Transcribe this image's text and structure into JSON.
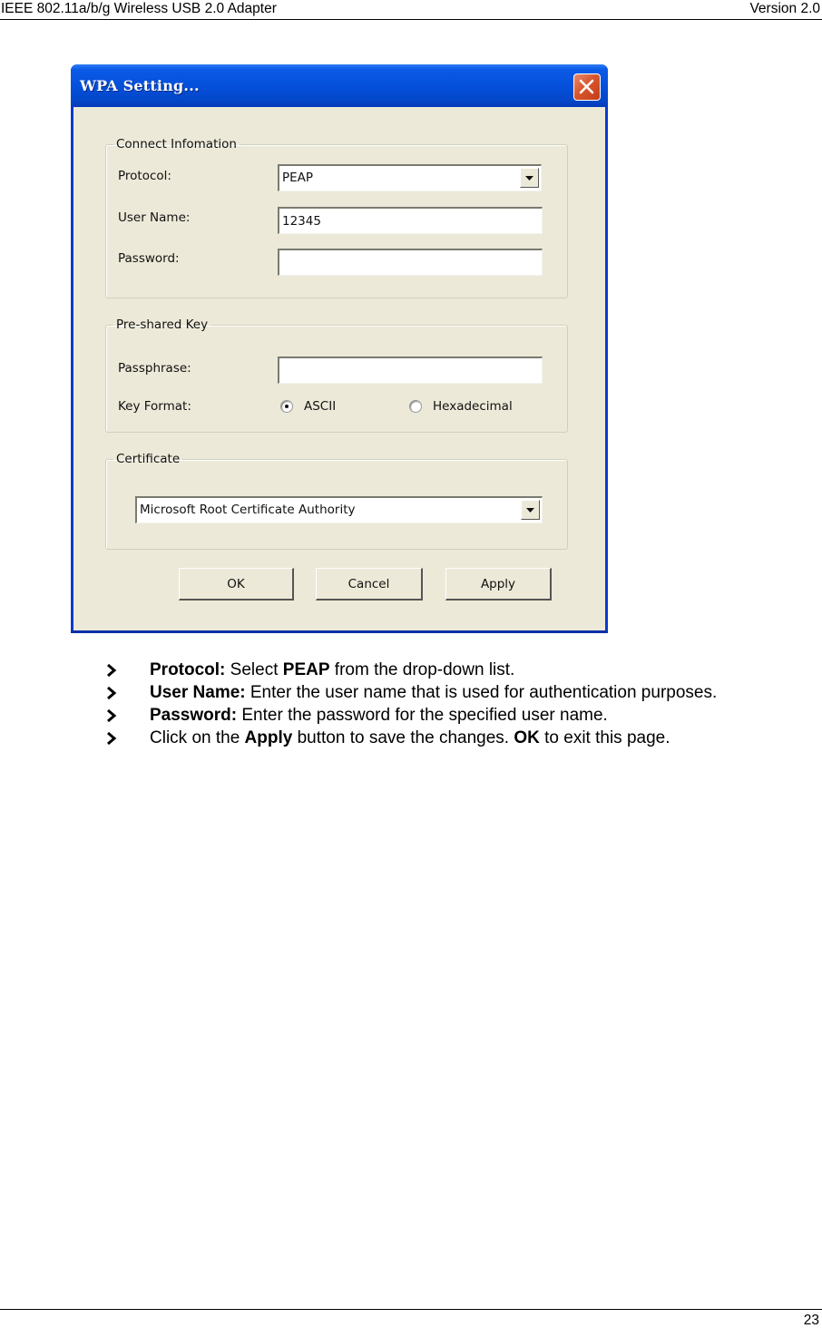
{
  "page_header": {
    "left": "IEEE 802.11a/b/g Wireless USB 2.0 Adapter",
    "right": "Version 2.0"
  },
  "dialog": {
    "title": "WPA Setting...",
    "close_icon": "close-icon",
    "connect_group": {
      "legend": "Connect Infomation",
      "protocol_label": "Protocol:",
      "protocol_value": "PEAP",
      "username_label": "User Name:",
      "username_value": "12345",
      "password_label": "Password:",
      "password_value": ""
    },
    "psk_group": {
      "legend": "Pre-shared Key",
      "passphrase_label": "Passphrase:",
      "passphrase_value": "",
      "keyformat_label": "Key Format:",
      "options": [
        {
          "label": "ASCII",
          "selected": true
        },
        {
          "label": "Hexadecimal",
          "selected": false
        }
      ]
    },
    "certificate_group": {
      "legend": "Certificate",
      "value": "Microsoft Root Certificate Authority"
    },
    "buttons": {
      "ok": "OK",
      "cancel": "Cancel",
      "apply": "Apply"
    }
  },
  "bullets": [
    {
      "parts": [
        {
          "b": "Protocol:"
        },
        {
          "t": " Select "
        },
        {
          "b": "PEAP"
        },
        {
          "t": " from the drop-down list."
        }
      ]
    },
    {
      "parts": [
        {
          "b": "User Name:"
        },
        {
          "t": " Enter the user name that is used for authentication purposes."
        }
      ]
    },
    {
      "parts": [
        {
          "b": "Password:"
        },
        {
          "t": " Enter the password for the specified user name."
        }
      ]
    },
    {
      "parts": [
        {
          "t": "Click on the "
        },
        {
          "b": "Apply"
        },
        {
          "t": " button to save the changes. "
        },
        {
          "b": "OK"
        },
        {
          "t": " to exit this page."
        }
      ]
    }
  ],
  "bullet_icon": "chevron-right-icon",
  "page_footer": {
    "page_number": "23"
  }
}
